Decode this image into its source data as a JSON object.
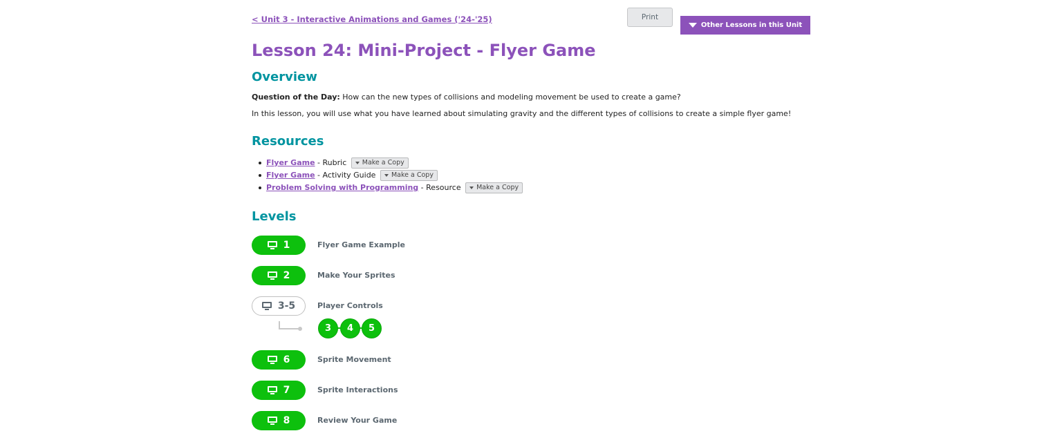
{
  "header": {
    "back_link": "< Unit 3 - Interactive Animations and Games ('24-'25)",
    "print_label": "Print",
    "other_lessons_label": "Other Lessons in this Unit"
  },
  "title": "Lesson 24: Mini-Project - Flyer Game",
  "overview": {
    "heading": "Overview",
    "qotd_label": "Question of the Day:",
    "qotd_text": " How can the new types of collisions and modeling movement be used to create a game?",
    "description": "In this lesson, you will use what you have learned about simulating gravity and the different types of collisions to create a simple flyer game!"
  },
  "resources": {
    "heading": "Resources",
    "items": [
      {
        "link": "Flyer Game",
        "suffix": " - Rubric",
        "copy": "Make a Copy"
      },
      {
        "link": "Flyer Game",
        "suffix": " - Activity Guide",
        "copy": "Make a Copy"
      },
      {
        "link": "Problem Solving with Programming",
        "suffix": " - Resource",
        "copy": "Make a Copy"
      }
    ]
  },
  "levels": {
    "heading": "Levels",
    "items": [
      {
        "number": "1",
        "name": "Flyer Game Example"
      },
      {
        "number": "2",
        "name": "Make Your Sprites"
      },
      {
        "number": "3-5",
        "name": "Player Controls",
        "sublevels": [
          "3",
          "4",
          "5"
        ]
      },
      {
        "number": "6",
        "name": "Sprite Movement"
      },
      {
        "number": "7",
        "name": "Sprite Interactions"
      },
      {
        "number": "8",
        "name": "Review Your Game"
      }
    ]
  },
  "colors": {
    "brand_purple": "#8c52ba",
    "heading_teal": "#0094a0",
    "level_green": "#0dc00d"
  }
}
